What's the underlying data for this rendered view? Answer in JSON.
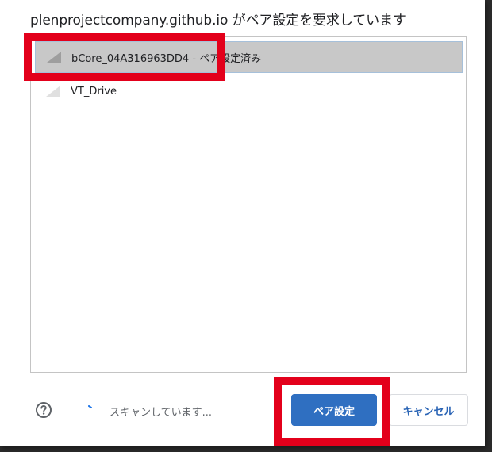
{
  "dialog": {
    "title": "plenprojectcompany.github.io がペア設定を要求しています"
  },
  "device_list": {
    "items": [
      {
        "label": "bCore_04A316963DD4 - ペア設定済み",
        "selected": true,
        "icon": "signal-strength-icon"
      },
      {
        "label": "VT_Drive",
        "selected": false,
        "icon": "signal-strength-icon"
      }
    ]
  },
  "footer": {
    "help_icon": "help-circle-icon",
    "status_text": "スキャンしています...",
    "pair_button_label": "ペア設定",
    "cancel_button_label": "キャンセル"
  },
  "colors": {
    "primary_button": "#2f6fc1",
    "selected_row": "#c8c8c8",
    "annotation_highlight": "#e3001b"
  }
}
